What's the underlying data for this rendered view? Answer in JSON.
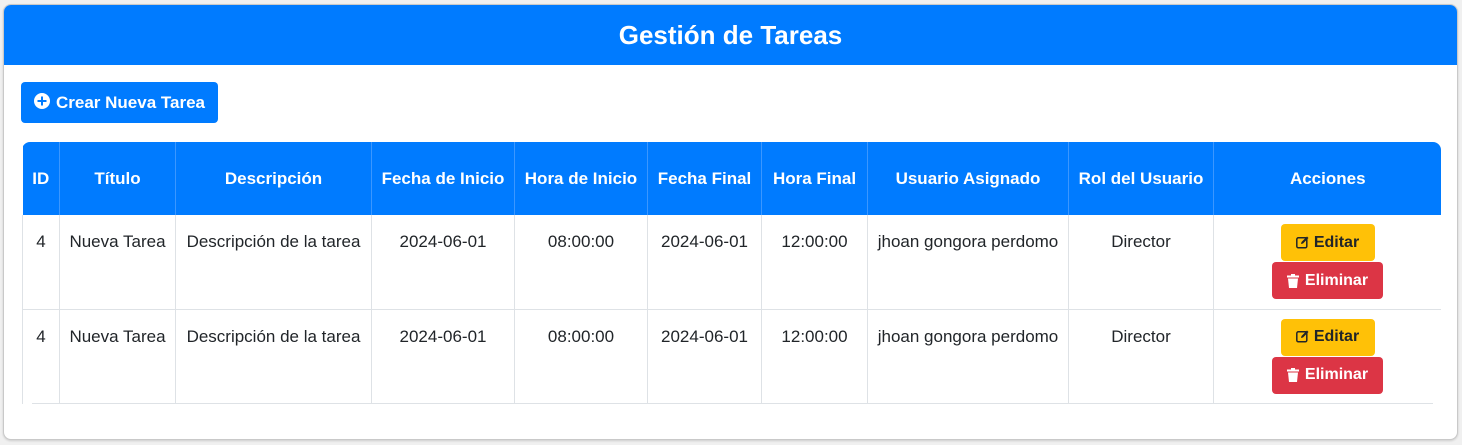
{
  "header": {
    "title": "Gestión de Tareas"
  },
  "toolbar": {
    "create_label": "Crear Nueva Tarea",
    "create_icon": "plus-circle-icon"
  },
  "table": {
    "columns": [
      "ID",
      "Título",
      "Descripción",
      "Fecha de Inicio",
      "Hora de Inicio",
      "Fecha Final",
      "Hora Final",
      "Usuario Asignado",
      "Rol del Usuario",
      "Acciones"
    ],
    "rows": [
      {
        "id": "4",
        "titulo": "Nueva Tarea",
        "descripcion": "Descripción de la tarea",
        "fecha_inicio": "2024-06-01",
        "hora_inicio": "08:00:00",
        "fecha_final": "2024-06-01",
        "hora_final": "12:00:00",
        "usuario": "jhoan gongora perdomo",
        "rol": "Director",
        "edit_label": "Editar",
        "delete_label": "Eliminar"
      },
      {
        "id": "4",
        "titulo": "Nueva Tarea",
        "descripcion": "Descripción de la tarea",
        "fecha_inicio": "2024-06-01",
        "hora_inicio": "08:00:00",
        "fecha_final": "2024-06-01",
        "hora_final": "12:00:00",
        "usuario": "jhoan gongora perdomo",
        "rol": "Director",
        "edit_label": "Editar",
        "delete_label": "Eliminar"
      }
    ]
  },
  "colors": {
    "primary": "#007bff",
    "warning": "#ffc107",
    "danger": "#dc3545"
  }
}
